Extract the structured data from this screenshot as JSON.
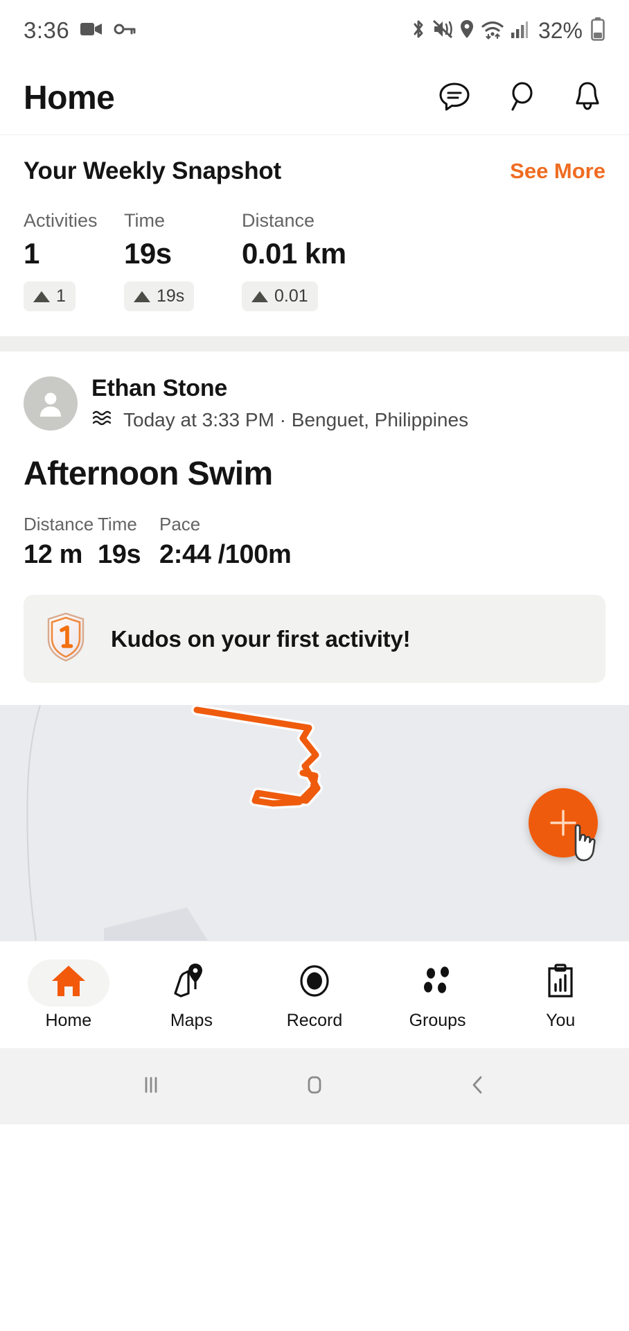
{
  "status_bar": {
    "time": "3:36",
    "battery_percent": "32%",
    "left_icons": [
      "video-camera-icon",
      "key-icon"
    ],
    "right_icons": [
      "bluetooth-icon",
      "mute-vibrate-icon",
      "location-icon",
      "wifi-icon",
      "cellular-signal-icon",
      "battery-icon"
    ]
  },
  "header": {
    "title": "Home",
    "actions": [
      {
        "name": "messages-icon",
        "label": "Messages"
      },
      {
        "name": "search-icon",
        "label": "Search"
      },
      {
        "name": "notifications-bell-icon",
        "label": "Notifications"
      }
    ]
  },
  "snapshot": {
    "title": "Your Weekly Snapshot",
    "see_more": "See More",
    "stats": [
      {
        "label": "Activities",
        "value": "1",
        "delta": "1"
      },
      {
        "label": "Time",
        "value": "19s",
        "delta": "19s"
      },
      {
        "label": "Distance",
        "value": "0.01 km",
        "delta": "0.01"
      }
    ]
  },
  "activity": {
    "user_name": "Ethan Stone",
    "sport_icon": "swim-waves-icon",
    "meta": "Today at 3:33 PM · Benguet, Philippines",
    "title": "Afternoon Swim",
    "stats": [
      {
        "label": "Distance",
        "value": "12 m"
      },
      {
        "label": "Time",
        "value": "19s"
      },
      {
        "label": "Pace",
        "value": "2:44 /100m"
      }
    ],
    "kudos": {
      "badge_number": "1",
      "text": "Kudos on your first activity!"
    }
  },
  "map": {
    "route_color": "#ef5b0c",
    "background_color": "#eaebee",
    "fab_label": "+",
    "fab_color": "#ef5b0c"
  },
  "bottom_nav": {
    "items": [
      {
        "label": "Home",
        "icon": "home-icon",
        "active": true
      },
      {
        "label": "Maps",
        "icon": "map-pin-icon",
        "active": false
      },
      {
        "label": "Record",
        "icon": "record-circle-icon",
        "active": false
      },
      {
        "label": "Groups",
        "icon": "groups-dots-icon",
        "active": false
      },
      {
        "label": "You",
        "icon": "clipboard-chart-icon",
        "active": false
      }
    ]
  },
  "android_nav": {
    "recents": "recents-icon",
    "home": "home-square-icon",
    "back": "back-chevron-icon"
  },
  "colors": {
    "accent_orange": "#ef5b0c",
    "link_orange": "#ef6c21",
    "text_primary": "#141414",
    "text_secondary": "#646464",
    "chip_bg": "#f0f0ef"
  }
}
